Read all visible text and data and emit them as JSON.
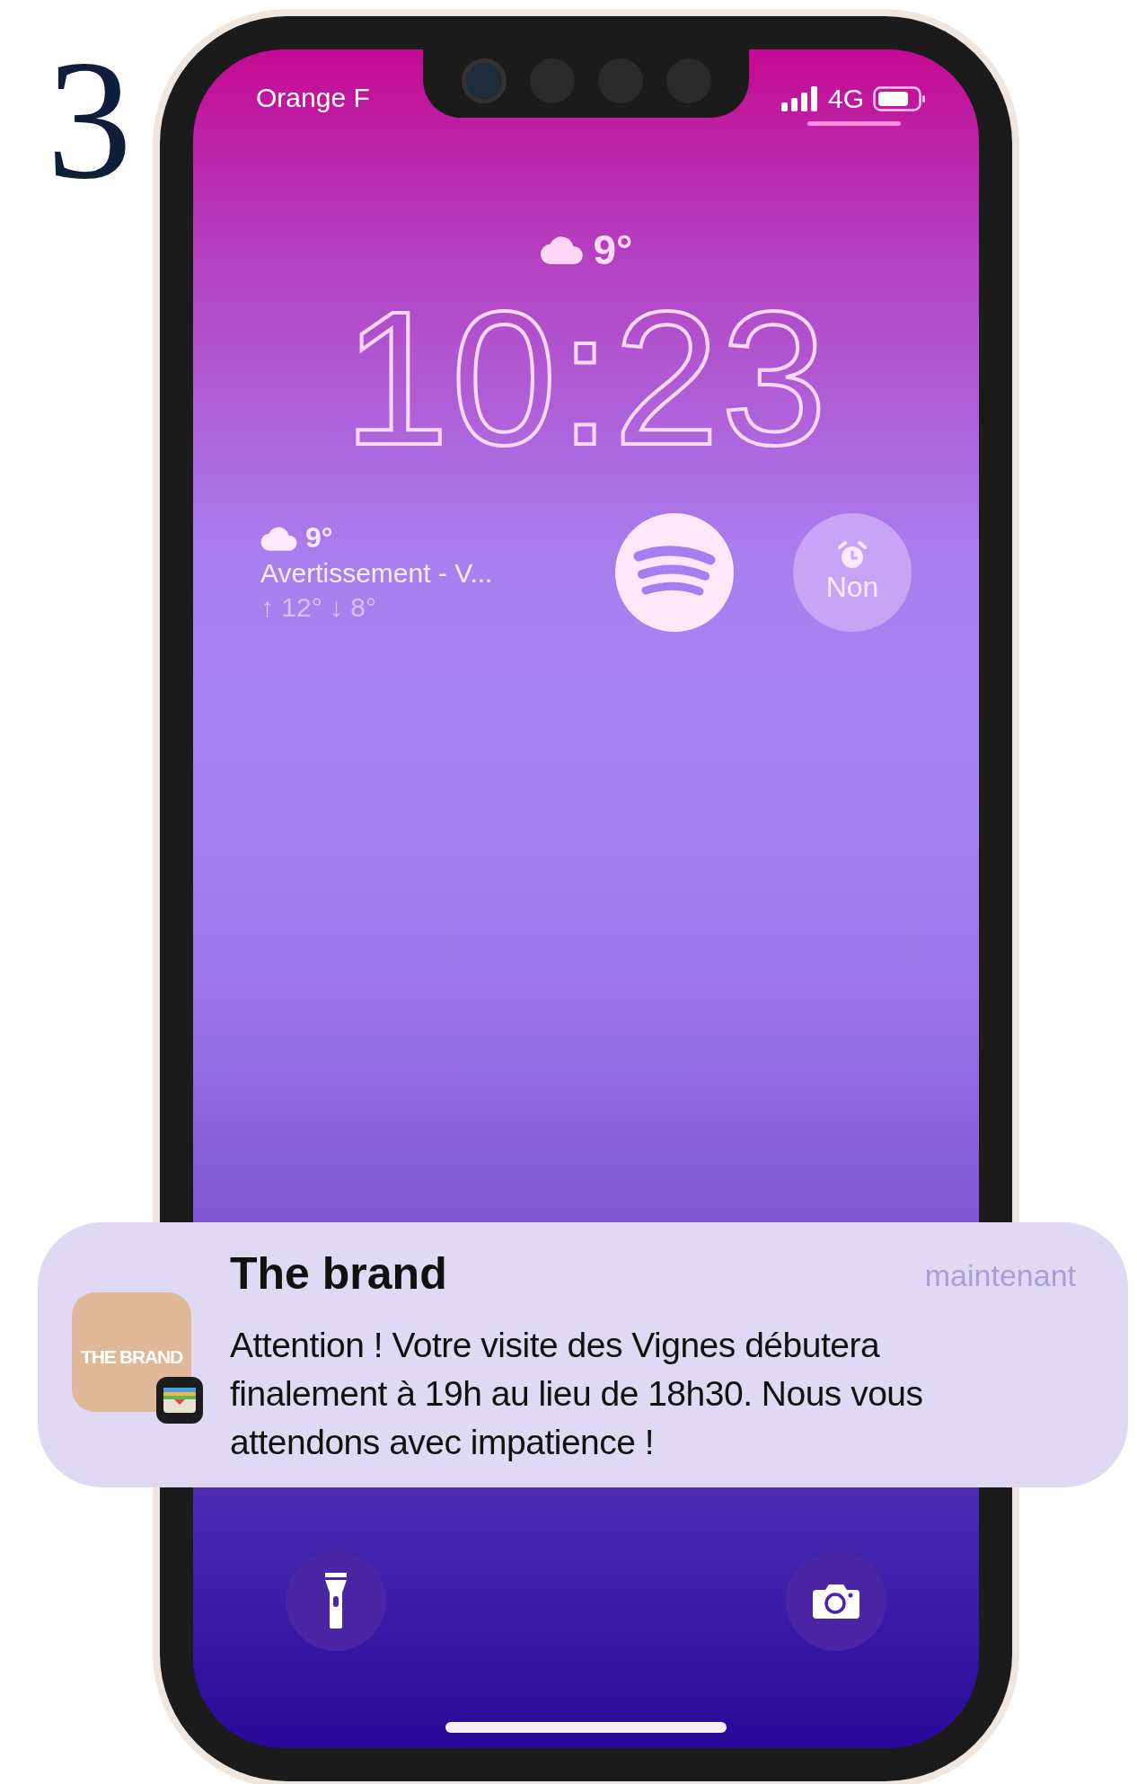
{
  "page_number": "3",
  "status_bar": {
    "carrier": "Orange F",
    "network": "4G"
  },
  "lock_screen": {
    "weather": {
      "temperature": "9°"
    },
    "time": "10:23",
    "widgets": [
      {
        "kind": "weather",
        "temperature": "9°",
        "condition": "Avertissement - V...",
        "range": "↑ 12° ↓ 8°"
      },
      {
        "kind": "music"
      },
      {
        "kind": "alarm",
        "label": "Non"
      }
    ]
  },
  "notification": {
    "app": "The brand",
    "time": "maintenant",
    "icon_text": "THE BRAND",
    "body": "Attention ! Votre visite des Vignes débutera finalement à 19h au lieu de 18h30. Nous vous attendons avec impatience !"
  },
  "quick_actions": [
    {
      "kind": "flashlight"
    },
    {
      "kind": "camera"
    }
  ]
}
